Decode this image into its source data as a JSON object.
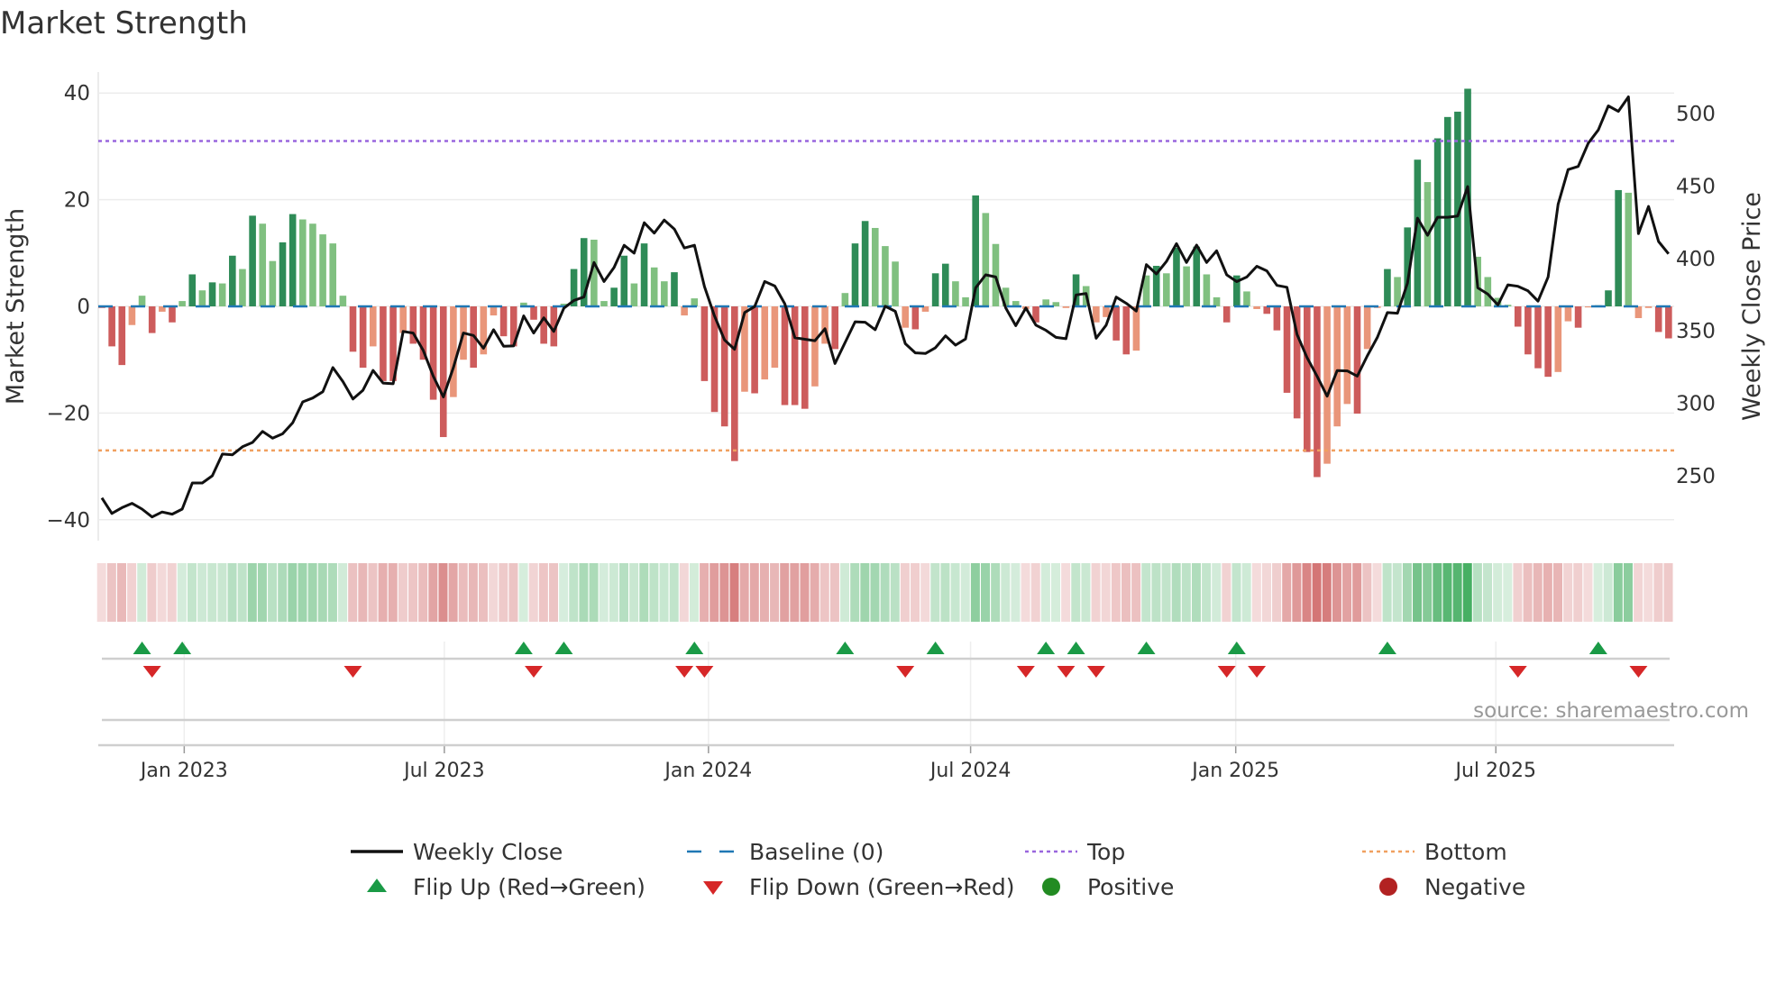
{
  "chart_data": {
    "type": "bar",
    "title": "Market Strength",
    "ylabel": "Market Strength",
    "y2label": "Weekly Close Price",
    "ylim": [
      -43,
      43
    ],
    "y2lim": [
      213,
      525
    ],
    "yticks": [
      "40",
      "20",
      "0",
      "−20",
      "−40"
    ],
    "ytick_values": [
      40,
      20,
      0,
      -20,
      -40
    ],
    "y2ticks": [
      "500",
      "450",
      "400",
      "350",
      "300",
      "250"
    ],
    "y2tick_values": [
      500,
      450,
      400,
      350,
      300,
      250
    ],
    "xticks": [
      "Jan 2023",
      "Jul 2023",
      "Jan 2024",
      "Jul 2024",
      "Jan 2025",
      "Jul 2025"
    ],
    "top_level": 31,
    "bottom_level": -27,
    "baseline": 0,
    "strength": [
      -0.3,
      -7.5,
      -11,
      -3.5,
      2,
      -5,
      -1,
      -3,
      1,
      6,
      3,
      4.5,
      4.3,
      9.5,
      7,
      17,
      15.5,
      8.5,
      12,
      17.3,
      16.3,
      15.5,
      13.5,
      11.8,
      2,
      -8.5,
      -11.5,
      -7.5,
      -14,
      -14,
      -5,
      -7,
      -10,
      -17.5,
      -24.5,
      -17,
      -10,
      -11.5,
      -9,
      -1.7,
      -5.6,
      -7.5,
      0.7,
      -2.5,
      -7,
      -7.5,
      0.5,
      7,
      12.8,
      12.5,
      1,
      3.5,
      9.5,
      4.3,
      11.8,
      7.3,
      4.7,
      6.4,
      -1.7,
      1.5,
      -14,
      -19.8,
      -22.5,
      -29,
      -16,
      -16.3,
      -13.7,
      -11.5,
      -18.5,
      -18.5,
      -19.2,
      -15,
      -7,
      -8,
      2.5,
      11.8,
      16,
      14.7,
      11.3,
      8.4,
      -4,
      -4.3,
      -1,
      6.2,
      8,
      4.7,
      1.7,
      20.8,
      17.5,
      11.7,
      3.5,
      1,
      -0.5,
      -3,
      1.3,
      0.8,
      -0.3,
      6,
      3.8,
      -3,
      -2,
      -6.4,
      -9,
      -8.3,
      5.8,
      7.6,
      6.2,
      11,
      7.5,
      11.2,
      6,
      1.7,
      -3,
      5.8,
      2.8,
      -0.5,
      -1.4,
      -4.5,
      -16.2,
      -21,
      -27.3,
      -32,
      -29.5,
      -22.5,
      -18.3,
      -20.1,
      -8,
      -0.3,
      7,
      5.5,
      14.8,
      27.5,
      23.3,
      31.5,
      35.5,
      36.5,
      40.8,
      9.3,
      5.5,
      1.6,
      0.3,
      -3.8,
      -9,
      -11.6,
      -13.2,
      -12.3,
      -2.8,
      -4,
      -0.2,
      0.2,
      3,
      21.8,
      21.3,
      -2.2,
      -0.3,
      -4.8,
      -6
    ],
    "weekly_close": [
      234.7,
      224,
      228,
      231,
      227,
      221.6,
      225,
      223.5,
      227,
      245,
      245,
      250,
      265,
      264.5,
      270,
      273,
      280.6,
      276,
      279,
      286.6,
      301,
      303.7,
      308,
      324.7,
      315,
      303,
      309,
      322.7,
      314,
      313.5,
      349.6,
      348.5,
      336.5,
      318.7,
      304.4,
      324.7,
      348.5,
      346.8,
      338,
      350.8,
      339.4,
      339.6,
      360.3,
      348.5,
      359,
      349.6,
      365.6,
      371,
      373.4,
      397.2,
      384.1,
      393.7,
      409.1,
      403.7,
      424.6,
      417.5,
      426.5,
      420.3,
      407.2,
      409.1,
      380.6,
      360.3,
      343.7,
      337.3,
      362.7,
      366.8,
      384.1,
      381,
      368.7,
      345.3,
      344.2,
      343.2,
      351.5,
      327.5,
      342,
      356.3,
      356,
      350.8,
      367,
      363.5,
      341.2,
      334.8,
      334.4,
      338.4,
      346.6,
      340.2,
      344.4,
      379.7,
      388.7,
      387.2,
      365.8,
      353.6,
      365.8,
      354,
      350.4,
      345.5,
      344.6,
      374.8,
      375.8,
      344.9,
      354,
      373.3,
      369,
      363.7,
      395.7,
      389.3,
      397.9,
      410.2,
      397.2,
      409.2,
      397.2,
      405.3,
      388.7,
      384,
      387.2,
      394.6,
      391.4,
      381.4,
      380.1,
      347.6,
      331.6,
      318.8,
      304.9,
      322.6,
      322.4,
      318.8,
      332.7,
      345.5,
      362.6,
      362.2,
      382.9,
      427.8,
      416,
      428.4,
      428.4,
      429.3,
      449.6,
      379.7,
      375.4,
      367.9,
      381.8,
      380.8,
      377.6,
      370.5,
      387.2,
      437.4,
      461.3,
      463.5,
      479.5,
      488.7,
      505.3,
      501.5,
      511.5,
      417.1,
      435.9,
      411.7,
      403.2
    ],
    "legend": [
      {
        "label": "Weekly Close",
        "symbol": "line",
        "color": "#111111"
      },
      {
        "label": "Baseline (0)",
        "symbol": "dash",
        "color": "#1f77b4"
      },
      {
        "label": "Top",
        "symbol": "dot",
        "color": "#9966dd"
      },
      {
        "label": "Bottom",
        "symbol": "dot",
        "color": "#f0a060"
      },
      {
        "label": "Flip Up (Red→Green)",
        "symbol": "triangle-up",
        "color": "#1a9a46"
      },
      {
        "label": "Flip Down (Green→Red)",
        "symbol": "triangle-down",
        "color": "#d62728"
      },
      {
        "label": "Positive",
        "symbol": "circle",
        "color": "#228b22"
      },
      {
        "label": "Negative",
        "symbol": "circle",
        "color": "#b22222"
      }
    ],
    "legend_placement": "bottom",
    "grid": true
  },
  "colors": {
    "pos_strong": "#2e8b57",
    "pos_weak": "#80c080",
    "neg_strong": "#cd5c5c",
    "neg_weak": "#e9967a"
  },
  "source": "source: sharemaestro.com"
}
